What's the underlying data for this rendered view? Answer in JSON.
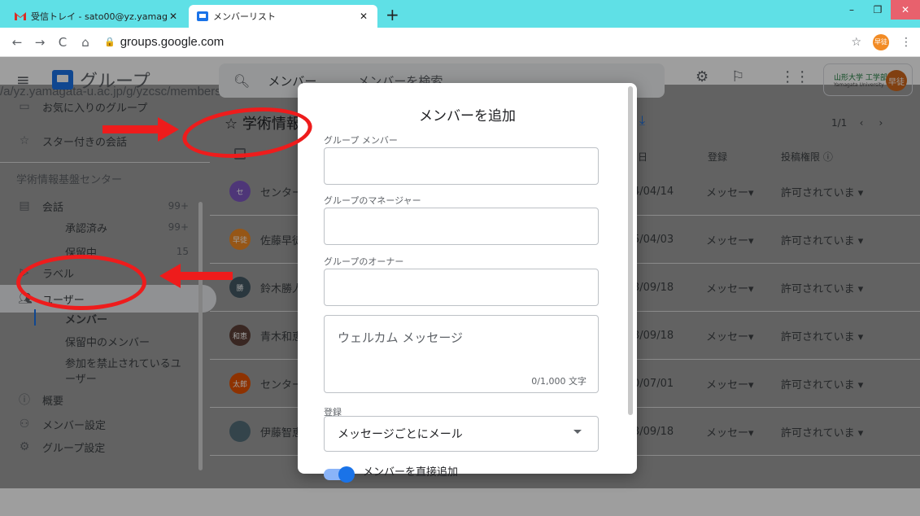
{
  "browser": {
    "tabs": [
      {
        "title": "受信トレイ - sato00@yz.yamaga",
        "icon": "gmail-icon"
      },
      {
        "title": "メンバーリスト",
        "icon": "groups-icon"
      }
    ],
    "url_host": "groups.google.com",
    "url_path": "/a/yz.yamagata-u.ac.jp/g/yzcsc/members",
    "profile_label": "早徒"
  },
  "app": {
    "name": "グループ",
    "search_scope": "メンバー",
    "search_placeholder": "メンバーを検索",
    "org_name": "山形大学 工学部",
    "org_sub": "Yamagata University",
    "avatar_label": "早徒"
  },
  "sidebar": {
    "fav_groups": "お気に入りのグループ",
    "starred": "スター付きの会話",
    "section": "学術情報基盤センター",
    "conversations": {
      "label": "会話",
      "count": "99+"
    },
    "approved": {
      "label": "承認済み",
      "count": "99+"
    },
    "pending": {
      "label": "保留中",
      "count": "15"
    },
    "labels": "ラベル",
    "users": "ユーザー",
    "members": "メンバー",
    "pending_members": "保留中のメンバー",
    "banned_line1": "参加を禁止されているユ",
    "banned_line2": "ーザー",
    "overview": "概要",
    "member_settings": "メンバー設定",
    "group_settings": "グループ設定"
  },
  "main": {
    "group_title": "学術情報",
    "pager": "1/1",
    "col_date": "日",
    "col_sub": "登録",
    "col_post": "投稿権限",
    "rows": [
      {
        "name": "センター",
        "avatar": "セ",
        "color": "#7e57c2",
        "date": "4/04/14",
        "sub": "メッセー",
        "post": "許可されていま"
      },
      {
        "name": "佐藤早徒",
        "avatar": "早徒",
        "color": "#f28b24",
        "date": "5/04/03",
        "sub": "メッセー",
        "post": "許可されていま"
      },
      {
        "name": "鈴木勝人",
        "avatar": "勝",
        "color": "#455a64",
        "date": "3/09/18",
        "sub": "メッセー",
        "post": "許可されていま"
      },
      {
        "name": "青木和恵",
        "avatar": "和恵",
        "color": "#5d4037",
        "date": "3/09/18",
        "sub": "メッセー",
        "post": "許可されていま"
      },
      {
        "name": "センター",
        "avatar": "太郎",
        "color": "#e65100",
        "date": "0/07/01",
        "sub": "メッセー",
        "post": "許可されていま"
      },
      {
        "name": "伊藤智恵",
        "avatar": "",
        "color": "#546e7a",
        "date": "3/09/18",
        "sub": "メッセー",
        "post": "許可されていま"
      }
    ]
  },
  "modal": {
    "title": "メンバーを追加",
    "group_members_label": "グループ メンバー",
    "managers_label": "グループのマネージャー",
    "owners_label": "グループのオーナー",
    "welcome_placeholder": "ウェルカム メッセージ",
    "welcome_counter": "0/1,000 文字",
    "subscription_label": "登録",
    "subscription_value": "メッセージごとにメール",
    "direct_add_label": "メンバーを直接追加"
  },
  "colors": {
    "accent": "#1a73e8",
    "annotation": "#ee1c1c",
    "tabstrip": "#5fe0e6"
  }
}
